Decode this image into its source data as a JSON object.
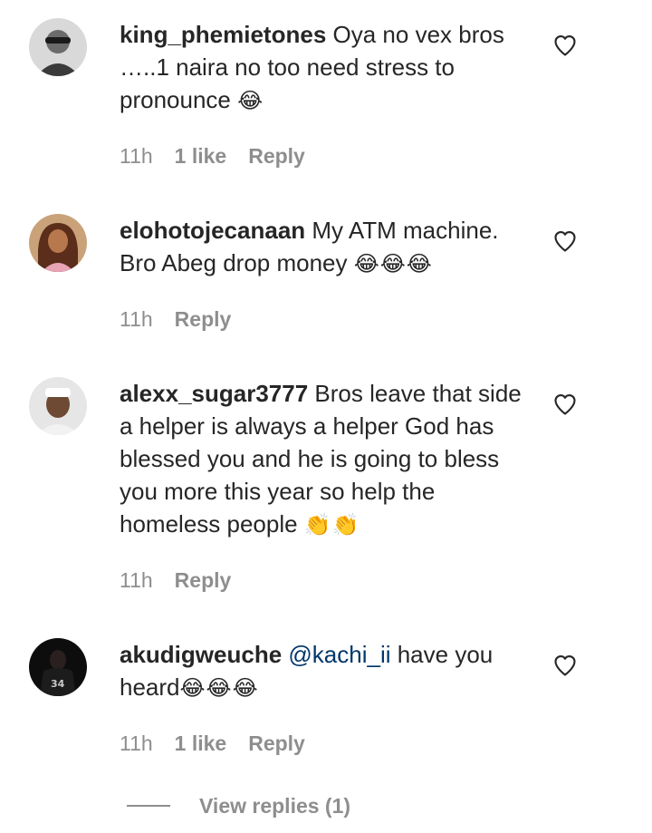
{
  "comments": [
    {
      "username": "king_phemietones",
      "text": "Oya no vex bros …..1 naira no too need stress to pronounce ",
      "emoji": "😂",
      "time": "11h",
      "likes": "1 like",
      "reply": "Reply"
    },
    {
      "username": "elohotojecanaan",
      "text": "My ATM machine. Bro Abeg drop money ",
      "emoji": "😂😂😂",
      "time": "11h",
      "reply": "Reply"
    },
    {
      "username": "alexx_sugar3777",
      "text": "Bros leave that side a helper is always a helper God has blessed you and he is going to bless you more this year so help the homeless people ",
      "emoji": "👏👏",
      "time": "11h",
      "reply": "Reply"
    },
    {
      "username": "akudigweuche",
      "mention": "@kachi_ii",
      "text": " have you heard",
      "emoji": "😂😂😂",
      "time": "11h",
      "likes": "1 like",
      "reply": "Reply"
    }
  ],
  "view_replies": "View replies (1)",
  "icons": {
    "like": "heart-outline-icon"
  },
  "colors": {
    "text": "#262626",
    "secondary": "#8e8e8e",
    "mention": "#00376b"
  }
}
